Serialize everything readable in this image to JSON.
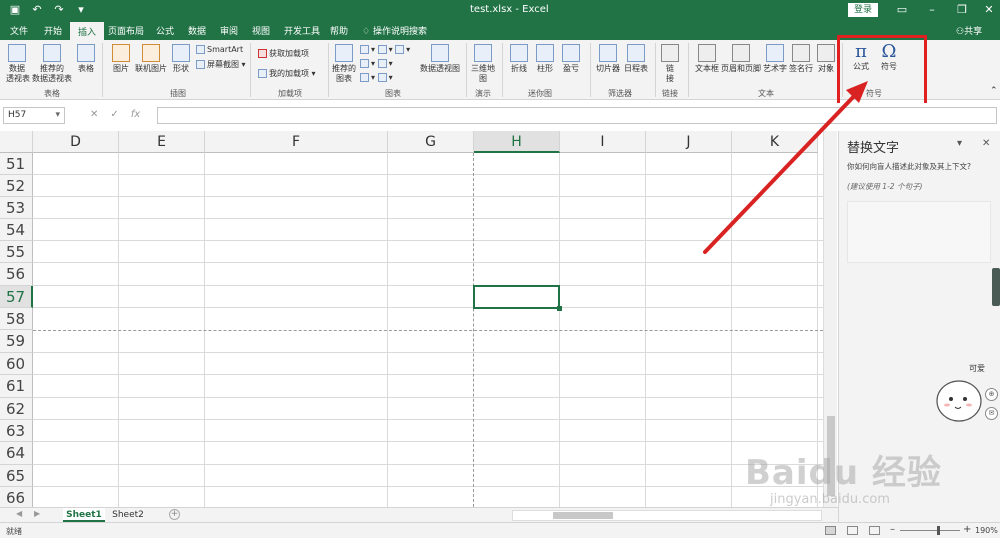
{
  "title_bar": {
    "title": "test.xlsx  -  Excel",
    "login": "登录"
  },
  "tabs": [
    "文件",
    "开始",
    "插入",
    "页面布局",
    "公式",
    "数据",
    "审阅",
    "视图",
    "开发工具",
    "帮助"
  ],
  "active_tab": "插入",
  "tell_me": "操作说明搜索",
  "share": "共享",
  "ribbon": {
    "table_group": {
      "pivot": "数据\n透视表",
      "recommended_pivot": "推荐的\n数据透视表",
      "table": "表格",
      "label": "表格"
    },
    "illustrations_group": {
      "pictures": "图片",
      "online_pictures": "联机图片",
      "shapes": "形状",
      "smartart": "SmartArt",
      "screenshot": "屏幕截图",
      "label": "插图"
    },
    "addins_group": {
      "get_addins": "获取加载项",
      "my_addins": "我的加载项",
      "label": "加载项"
    },
    "charts_group": {
      "recommended_charts": "推荐的\n图表",
      "pivot_chart": "数据透视图",
      "label": "图表"
    },
    "tours_group": {
      "map_3d": "三维地\n图",
      "label": "演示"
    },
    "sparklines_group": {
      "line": "折线",
      "column": "柱形",
      "win_loss": "盈亏",
      "label": "迷你图"
    },
    "filters_group": {
      "slicer": "切片器",
      "timeline": "日程表",
      "label": "筛选器"
    },
    "links_group": {
      "link": "链\n接",
      "label": "链接"
    },
    "text_group": {
      "textbox": "文本框",
      "header_footer": "页眉和页脚",
      "wordart": "艺术字",
      "signature": "签名行",
      "object": "对象",
      "label": "文本"
    },
    "symbols_group": {
      "equation": "公式",
      "symbol": "符号",
      "label": "符号",
      "equation_glyph": "π",
      "symbol_glyph": "Ω"
    }
  },
  "formula_bar": {
    "name_box": "H57",
    "formula": ""
  },
  "columns": [
    "D",
    "E",
    "F",
    "G",
    "H",
    "I",
    "J",
    "K"
  ],
  "selected_column": "H",
  "rows": [
    "51",
    "52",
    "53",
    "54",
    "55",
    "56",
    "57",
    "58",
    "59",
    "60",
    "61",
    "62",
    "63",
    "64",
    "65",
    "66"
  ],
  "selected_row": "57",
  "active_cell": "H57",
  "pane": {
    "title": "替换文字",
    "question": "你如何向盲人描述此对象及其上下文?",
    "hint": "(建议使用 1-2 个句子)",
    "textarea_value": ""
  },
  "sticker_text": "可爱",
  "sheets": [
    "Sheet1",
    "Sheet2"
  ],
  "active_sheet": "Sheet1",
  "status": {
    "ready": "就绪",
    "zoom": "190%"
  },
  "watermark": {
    "main": "Baidu 经验",
    "sub": "jingyan.baidu.com"
  },
  "colors": {
    "excel_green": "#217346",
    "highlight_red": "#e02020",
    "arrow_red": "#d92222"
  }
}
